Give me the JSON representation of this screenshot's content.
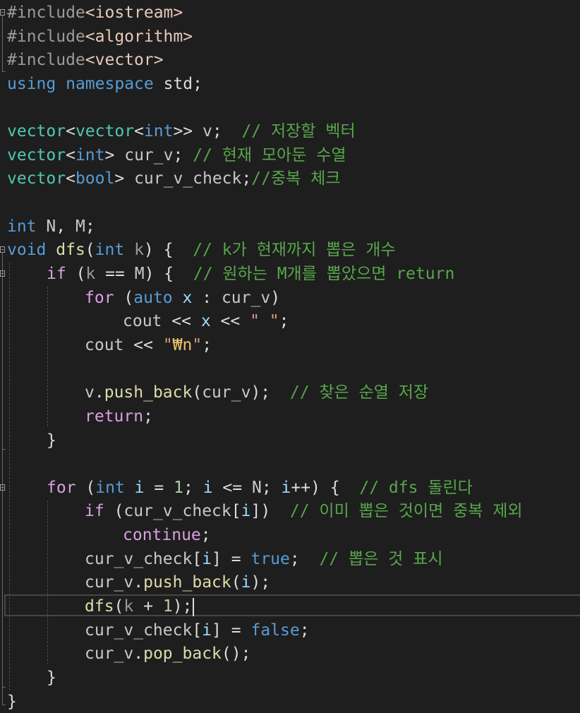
{
  "editor": {
    "lines": [
      [
        "#include",
        "<iostream>"
      ],
      [
        "#include",
        "<algorithm>"
      ],
      [
        "#include",
        "<vector>"
      ],
      [
        "using",
        "namespace",
        "std",
        ";"
      ],
      [],
      [
        "vector",
        "<",
        "vector",
        "<",
        "int",
        ">>",
        "v",
        ";",
        "// 저장할 벡터"
      ],
      [
        "vector",
        "<",
        "int",
        ">",
        "cur_v",
        ";",
        "// 현재 모아둔 수열"
      ],
      [
        "vector",
        "<",
        "bool",
        ">",
        "cur_v_check",
        ";",
        "//중복 체크"
      ],
      [],
      [
        "int",
        "N",
        ",",
        "M",
        ";"
      ],
      [
        "void",
        "dfs",
        "(",
        "int",
        "k",
        ")",
        "{",
        "// k가 현재까지 뽑은 개수"
      ],
      [
        "if",
        "(",
        "k",
        "==",
        "M",
        ")",
        "{",
        "// 원하는 M개를 뽑았으면 return"
      ],
      [
        "for",
        "(",
        "auto",
        "x",
        ":",
        "cur_v",
        ")"
      ],
      [
        "cout",
        "<<",
        "x",
        "<<",
        "\" \"",
        ";"
      ],
      [
        "cout",
        "<<",
        "\"",
        "₩n",
        "\"",
        ";"
      ],
      [],
      [
        "v",
        ".",
        "push_back",
        "(",
        "cur_v",
        ");",
        "// 찾은 순열 저장"
      ],
      [
        "return",
        ";"
      ],
      [
        "}"
      ],
      [],
      [
        "for",
        "(",
        "int",
        "i",
        "=",
        "1",
        ";",
        "i",
        "<=",
        "N",
        ";",
        "i",
        "++",
        ")",
        "{",
        "// dfs 돌린다"
      ],
      [
        "if",
        "(",
        "cur_v_check",
        "[",
        "i",
        "])",
        "// 이미 뽑은 것이면 중복 제외"
      ],
      [
        "continue",
        ";"
      ],
      [
        "cur_v_check",
        "[",
        "i",
        "]",
        "=",
        "true",
        ";",
        "// 뽑은 것 표시"
      ],
      [
        "cur_v",
        ".",
        "push_back",
        "(",
        "i",
        ");"
      ],
      [
        "dfs",
        "(",
        "k",
        "+",
        "1",
        ");"
      ],
      [
        "cur_v_check",
        "[",
        "i",
        "]",
        "=",
        "false",
        ";"
      ],
      [
        "cur_v",
        ".",
        "pop_back",
        "();"
      ],
      [
        "}"
      ],
      [
        "}"
      ]
    ]
  },
  "colors": {
    "background": "#1e1e1e",
    "keyword": "#569cd6",
    "control": "#d8a0df",
    "type": "#4ec9b0",
    "function": "#dcdcaa",
    "comment": "#57a64a",
    "string": "#d69d85"
  },
  "icons": [
    "collapse-icon"
  ]
}
